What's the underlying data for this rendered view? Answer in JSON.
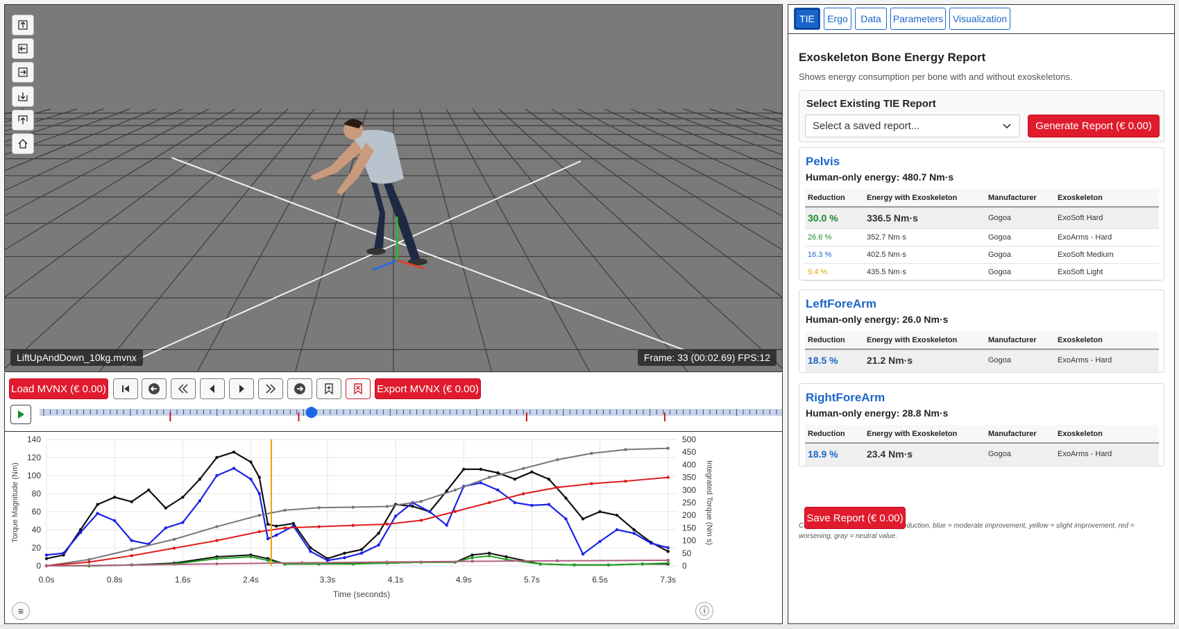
{
  "viewer": {
    "file_name": "LiftUpAndDown_10kg.mvnx",
    "frame_status": "Frame: 33 (00:02.69) FPS:12",
    "tools": [
      "view-up-icon",
      "view-left-icon",
      "view-right-icon",
      "view-down-icon",
      "view-front-icon",
      "home-icon"
    ]
  },
  "controls": {
    "load_label": "Load MVNX (€ 0.00)",
    "export_label": "Export MVNX (€ 0.00)",
    "playhead_fraction": 0.366,
    "markers_fraction": [
      0.176,
      0.349,
      0.656,
      0.842
    ]
  },
  "chart_data": {
    "type": "line",
    "xlabel": "Time (seconds)",
    "ylabel": "Torque Magnitude (Nm)",
    "y2label": "Integrated Torque (Nm s)",
    "ylim": [
      0,
      140
    ],
    "y2lim": [
      0,
      500
    ],
    "xlim": [
      0.0,
      7.4
    ],
    "yticks": [
      0,
      20,
      40,
      60,
      80,
      100,
      120,
      140
    ],
    "y2ticks": [
      0,
      50,
      100,
      150,
      200,
      250,
      300,
      350,
      400,
      450,
      500
    ],
    "xticks": [
      "0.0s",
      "0.8s",
      "1.6s",
      "2.4s",
      "3.3s",
      "4.1s",
      "4.9s",
      "5.7s",
      "6.5s",
      "7.3s"
    ],
    "cursor_x": 2.64,
    "series": [
      {
        "axis": "left",
        "color": "#111111",
        "x": [
          0.0,
          0.2,
          0.4,
          0.6,
          0.8,
          1.0,
          1.2,
          1.4,
          1.6,
          1.8,
          2.0,
          2.2,
          2.4,
          2.5,
          2.6,
          2.7,
          2.9,
          3.1,
          3.3,
          3.5,
          3.7,
          3.9,
          4.1,
          4.3,
          4.5,
          4.7,
          4.9,
          5.1,
          5.3,
          5.5,
          5.7,
          5.9,
          6.1,
          6.3,
          6.5,
          6.7,
          6.9,
          7.1,
          7.3
        ],
        "values": [
          8,
          12,
          40,
          68,
          76,
          71,
          84,
          64,
          76,
          96,
          120,
          126,
          115,
          98,
          46,
          44,
          47,
          20,
          8,
          14,
          18,
          36,
          68,
          66,
          60,
          83,
          107,
          107,
          103,
          96,
          104,
          96,
          75,
          52,
          60,
          56,
          40,
          26,
          16
        ]
      },
      {
        "axis": "left",
        "color": "#1a22e6",
        "x": [
          0.0,
          0.2,
          0.4,
          0.6,
          0.8,
          1.0,
          1.2,
          1.4,
          1.6,
          1.8,
          2.0,
          2.2,
          2.4,
          2.5,
          2.6,
          2.7,
          2.9,
          3.1,
          3.3,
          3.5,
          3.7,
          3.9,
          4.1,
          4.3,
          4.5,
          4.7,
          4.9,
          5.1,
          5.3,
          5.5,
          5.7,
          5.9,
          6.1,
          6.3,
          6.5,
          6.7,
          6.9,
          7.1,
          7.3
        ],
        "values": [
          12,
          14,
          37,
          58,
          50,
          28,
          24,
          42,
          48,
          72,
          100,
          108,
          96,
          80,
          30,
          34,
          44,
          16,
          6,
          9,
          14,
          23,
          55,
          70,
          60,
          45,
          88,
          92,
          84,
          70,
          67,
          68,
          52,
          13,
          27,
          40,
          36,
          25,
          20
        ]
      },
      {
        "axis": "left",
        "color": "#111111",
        "x": [
          0.0,
          0.5,
          1.0,
          1.5,
          2.0,
          2.4,
          2.6,
          2.8,
          3.2,
          3.6,
          4.0,
          4.4,
          4.8,
          5.0,
          5.2,
          5.4,
          5.8,
          6.2,
          6.6,
          7.0,
          7.3
        ],
        "values": [
          0,
          0,
          1,
          3,
          10,
          12,
          8,
          2,
          2,
          3,
          3,
          4,
          4,
          12,
          14,
          10,
          2,
          1,
          1,
          2,
          2
        ]
      },
      {
        "axis": "left",
        "color": "#22a022",
        "x": [
          0.0,
          0.5,
          1.0,
          1.5,
          2.0,
          2.4,
          2.6,
          2.8,
          3.2,
          3.6,
          4.0,
          4.4,
          4.8,
          5.0,
          5.2,
          5.4,
          5.8,
          6.2,
          6.6,
          7.0,
          7.3
        ],
        "values": [
          0,
          0,
          1,
          2,
          8,
          10,
          6,
          2,
          2,
          2,
          3,
          4,
          4,
          9,
          11,
          7,
          2,
          1,
          1,
          2,
          3
        ]
      },
      {
        "axis": "right",
        "color": "#777777",
        "x": [
          0.0,
          0.5,
          1.0,
          1.5,
          2.0,
          2.5,
          2.8,
          3.2,
          3.6,
          4.0,
          4.4,
          4.8,
          5.2,
          5.6,
          6.0,
          6.4,
          6.8,
          7.3
        ],
        "values": [
          0,
          25,
          65,
          105,
          155,
          200,
          220,
          230,
          232,
          235,
          255,
          300,
          350,
          385,
          420,
          445,
          460,
          465
        ]
      },
      {
        "axis": "right",
        "color": "#e01b1b",
        "x": [
          0.0,
          0.5,
          1.0,
          1.5,
          2.0,
          2.5,
          2.8,
          3.2,
          3.6,
          4.0,
          4.4,
          4.8,
          5.2,
          5.6,
          6.0,
          6.4,
          6.8,
          7.3
        ],
        "values": [
          0,
          15,
          40,
          70,
          100,
          135,
          150,
          155,
          160,
          165,
          180,
          215,
          250,
          285,
          310,
          325,
          335,
          350
        ]
      },
      {
        "axis": "right",
        "color": "#b06080",
        "x": [
          0.0,
          1.0,
          2.0,
          3.0,
          4.0,
          5.0,
          6.0,
          7.3
        ],
        "values": [
          0,
          3,
          8,
          12,
          15,
          18,
          20,
          22
        ]
      }
    ]
  },
  "tabs": [
    {
      "label": "TIE",
      "active": true
    },
    {
      "label": "Ergo",
      "active": false
    },
    {
      "label": "Data",
      "active": false
    },
    {
      "label": "Parameters",
      "active": false
    },
    {
      "label": "Visualization",
      "active": false
    }
  ],
  "report": {
    "title": "Exoskeleton Bone Energy Report",
    "description": "Shows energy consumption per bone with and without exoskeletons.",
    "select_title": "Select Existing TIE Report",
    "select_placeholder": "Select a saved report...",
    "generate_label": "Generate Report (€ 0.00)",
    "headers": [
      "Reduction",
      "Energy with Exoskeleton",
      "Manufacturer",
      "Exoskeleton"
    ],
    "human_only_label": "Human-only energy:",
    "bones": [
      {
        "name": "Pelvis",
        "energy": "480.7 Nm·s",
        "rows": [
          {
            "reduction": "30.0 %",
            "color": "#1a8a2a",
            "energy": "336.5 Nm·s",
            "manufacturer": "Gogoa",
            "exo": "ExoSoft Hard"
          },
          {
            "reduction": "26.6 %",
            "color": "#1a8a2a",
            "energy": "352.7 Nm·s",
            "manufacturer": "Gogoa",
            "exo": "ExoArms - Hard"
          },
          {
            "reduction": "16.3 %",
            "color": "#1a66c8",
            "energy": "402.5 Nm·s",
            "manufacturer": "Gogoa",
            "exo": "ExoSoft Medium"
          },
          {
            "reduction": "9.4 %",
            "color": "#e0a800",
            "energy": "435.5 Nm·s",
            "manufacturer": "Gogoa",
            "exo": "ExoSoft Light"
          }
        ]
      },
      {
        "name": "LeftForeArm",
        "energy": "26.0 Nm·s",
        "rows": [
          {
            "reduction": "18.5 %",
            "color": "#1a66c8",
            "energy": "21.2 Nm·s",
            "manufacturer": "Gogoa",
            "exo": "ExoArms - Hard"
          }
        ]
      },
      {
        "name": "RightForeArm",
        "energy": "28.8 Nm·s",
        "rows": [
          {
            "reduction": "18.9 %",
            "color": "#1a66c8",
            "energy": "23.4 Nm·s",
            "manufacturer": "Gogoa",
            "exo": "ExoArms - Hard"
          }
        ]
      }
    ],
    "legend_note": "Color legend: green = significant reduction, blue = moderate improvement, yellow = slight improvement, red = worsening, gray = neutral value.",
    "save_label": "Save Report (€ 0.00)"
  }
}
